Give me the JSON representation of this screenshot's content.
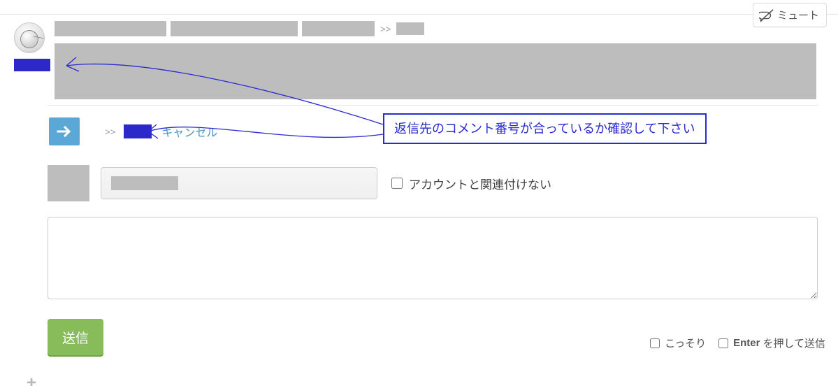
{
  "mute": {
    "label": "ミュート"
  },
  "header": {
    "reply_marker": ">>"
  },
  "reply": {
    "marker": ">>",
    "cancel_label": "キャンセル"
  },
  "callout": {
    "text": "返信先のコメント番号が合っているか確認して下さい"
  },
  "account": {
    "no_link_label": "アカウントと関連付けない"
  },
  "submit": {
    "label": "送信",
    "secret_label": "こっそり",
    "enter_send_label": "を押して送信",
    "enter_key": "Enter"
  },
  "textarea": {
    "value": ""
  }
}
